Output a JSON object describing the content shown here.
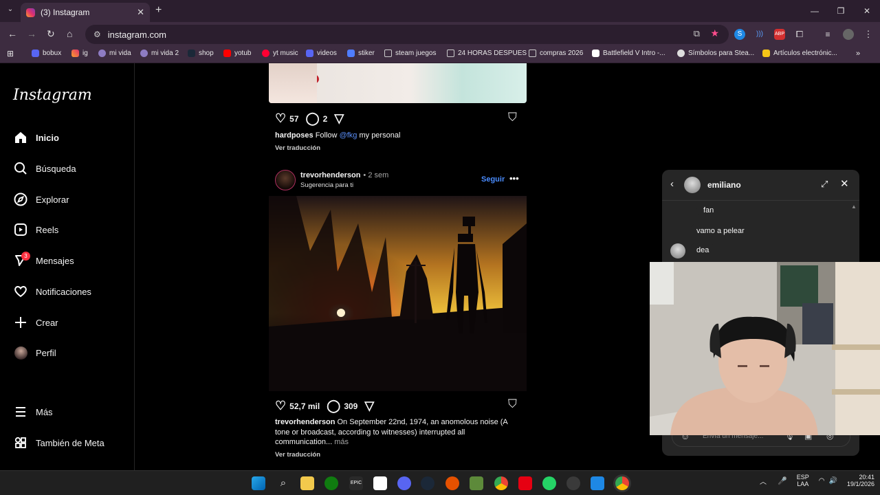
{
  "browser": {
    "tab_title": "(3) Instagram",
    "url": "instagram.com",
    "bookmarks": [
      "bobux",
      "ig",
      "mi vida",
      "mi vida 2",
      "shop",
      "yotub",
      "yt music",
      "videos",
      "stiker",
      "steam juegos",
      "24 HORAS DESPUES",
      "compras 2026",
      "Battlefield V Intro -...",
      "Símbolos para Stea...",
      "Artículos electrónic..."
    ]
  },
  "sidebar": {
    "logo": "Instagram",
    "items": [
      {
        "label": "Inicio",
        "icon": "home-icon"
      },
      {
        "label": "Búsqueda",
        "icon": "search-icon"
      },
      {
        "label": "Explorar",
        "icon": "compass-icon"
      },
      {
        "label": "Reels",
        "icon": "reels-icon"
      },
      {
        "label": "Mensajes",
        "icon": "messenger-icon"
      },
      {
        "label": "Notificaciones",
        "icon": "heart-icon"
      },
      {
        "label": "Crear",
        "icon": "plus-icon"
      },
      {
        "label": "Perfil",
        "icon": "avatar-icon"
      }
    ],
    "messages_badge": "3",
    "more": "Más",
    "meta": "También de Meta"
  },
  "post1": {
    "likes": "57",
    "comments": "2",
    "username": "hardposes",
    "caption_pre": "Follow",
    "mention": "@fkg",
    "caption_post": "my personal",
    "translate": "Ver traducción"
  },
  "post2": {
    "username": "trevorhenderson",
    "time": "• 2 sem",
    "suggestion": "Sugerencia para ti",
    "follow": "Seguir",
    "likes": "52,7 mil",
    "comments": "309",
    "caption_l1": "On September 22nd, 1974, an anomolous noise (A",
    "caption_l2": "tone or broadcast, according to witnesses) interrupted all",
    "caption_l3": "communication...",
    "more": "más",
    "translate": "Ver traducción"
  },
  "chat": {
    "name": "emiliano",
    "messages": [
      "fan",
      "vamo a pelear",
      "dea"
    ],
    "placeholder": "Envía un mensaje..."
  },
  "taskbar": {
    "lang1": "ESP",
    "lang2": "LAA",
    "time": "20:41",
    "date": "19/1/2026"
  }
}
